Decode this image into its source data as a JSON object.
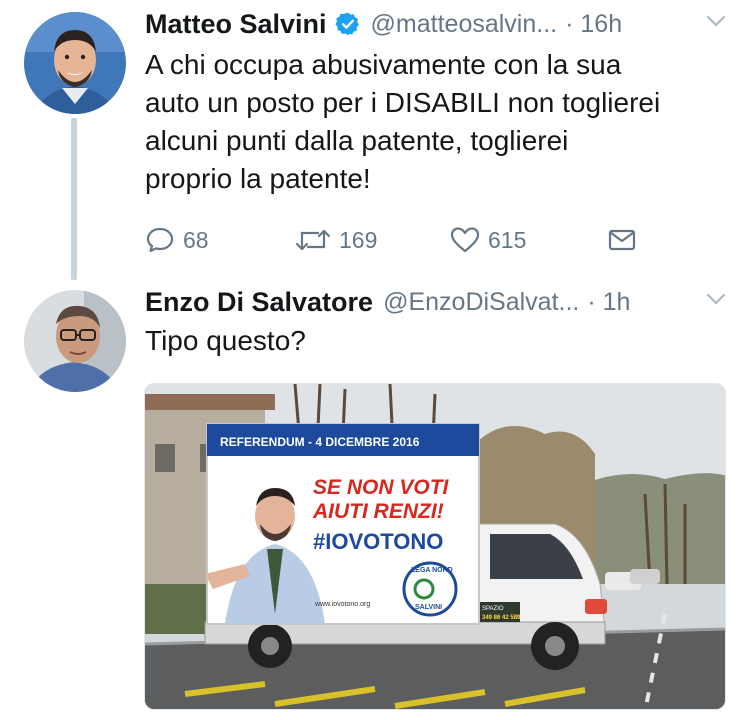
{
  "tweet1": {
    "name": "Matteo Salvini",
    "handle": "@matteosalvin...",
    "time": "· 16h",
    "text_lines": [
      "A chi occupa abusivamente con la sua",
      "auto un posto per i DISABILI non toglierei",
      "alcuni punti dalla patente, toglierei",
      "proprio la patente!"
    ],
    "replies": "68",
    "retweets": "169",
    "likes": "615"
  },
  "tweet2": {
    "name": "Enzo Di Salvatore",
    "handle": "@EnzoDiSalvat...",
    "time": "· 1h",
    "text": "Tipo questo?",
    "image": {
      "banner_top": "REFERENDUM - 4 DICEMBRE 2016",
      "slogan_line1": "SE NON VOTI",
      "slogan_line2": "AIUTI RENZI!",
      "hashtag": "#IOVOTONO",
      "website": "www.iovotono.org",
      "logo_top": "LEGA NORD",
      "logo_bottom": "SALVINI",
      "side_sign_line1": "SPAZIO",
      "side_sign_line2": "349 86 42 589"
    }
  },
  "colors": {
    "text": "#14171a",
    "secondary": "#657786",
    "verified": "#1da1f2",
    "thread_line": "#c9d3dc"
  }
}
